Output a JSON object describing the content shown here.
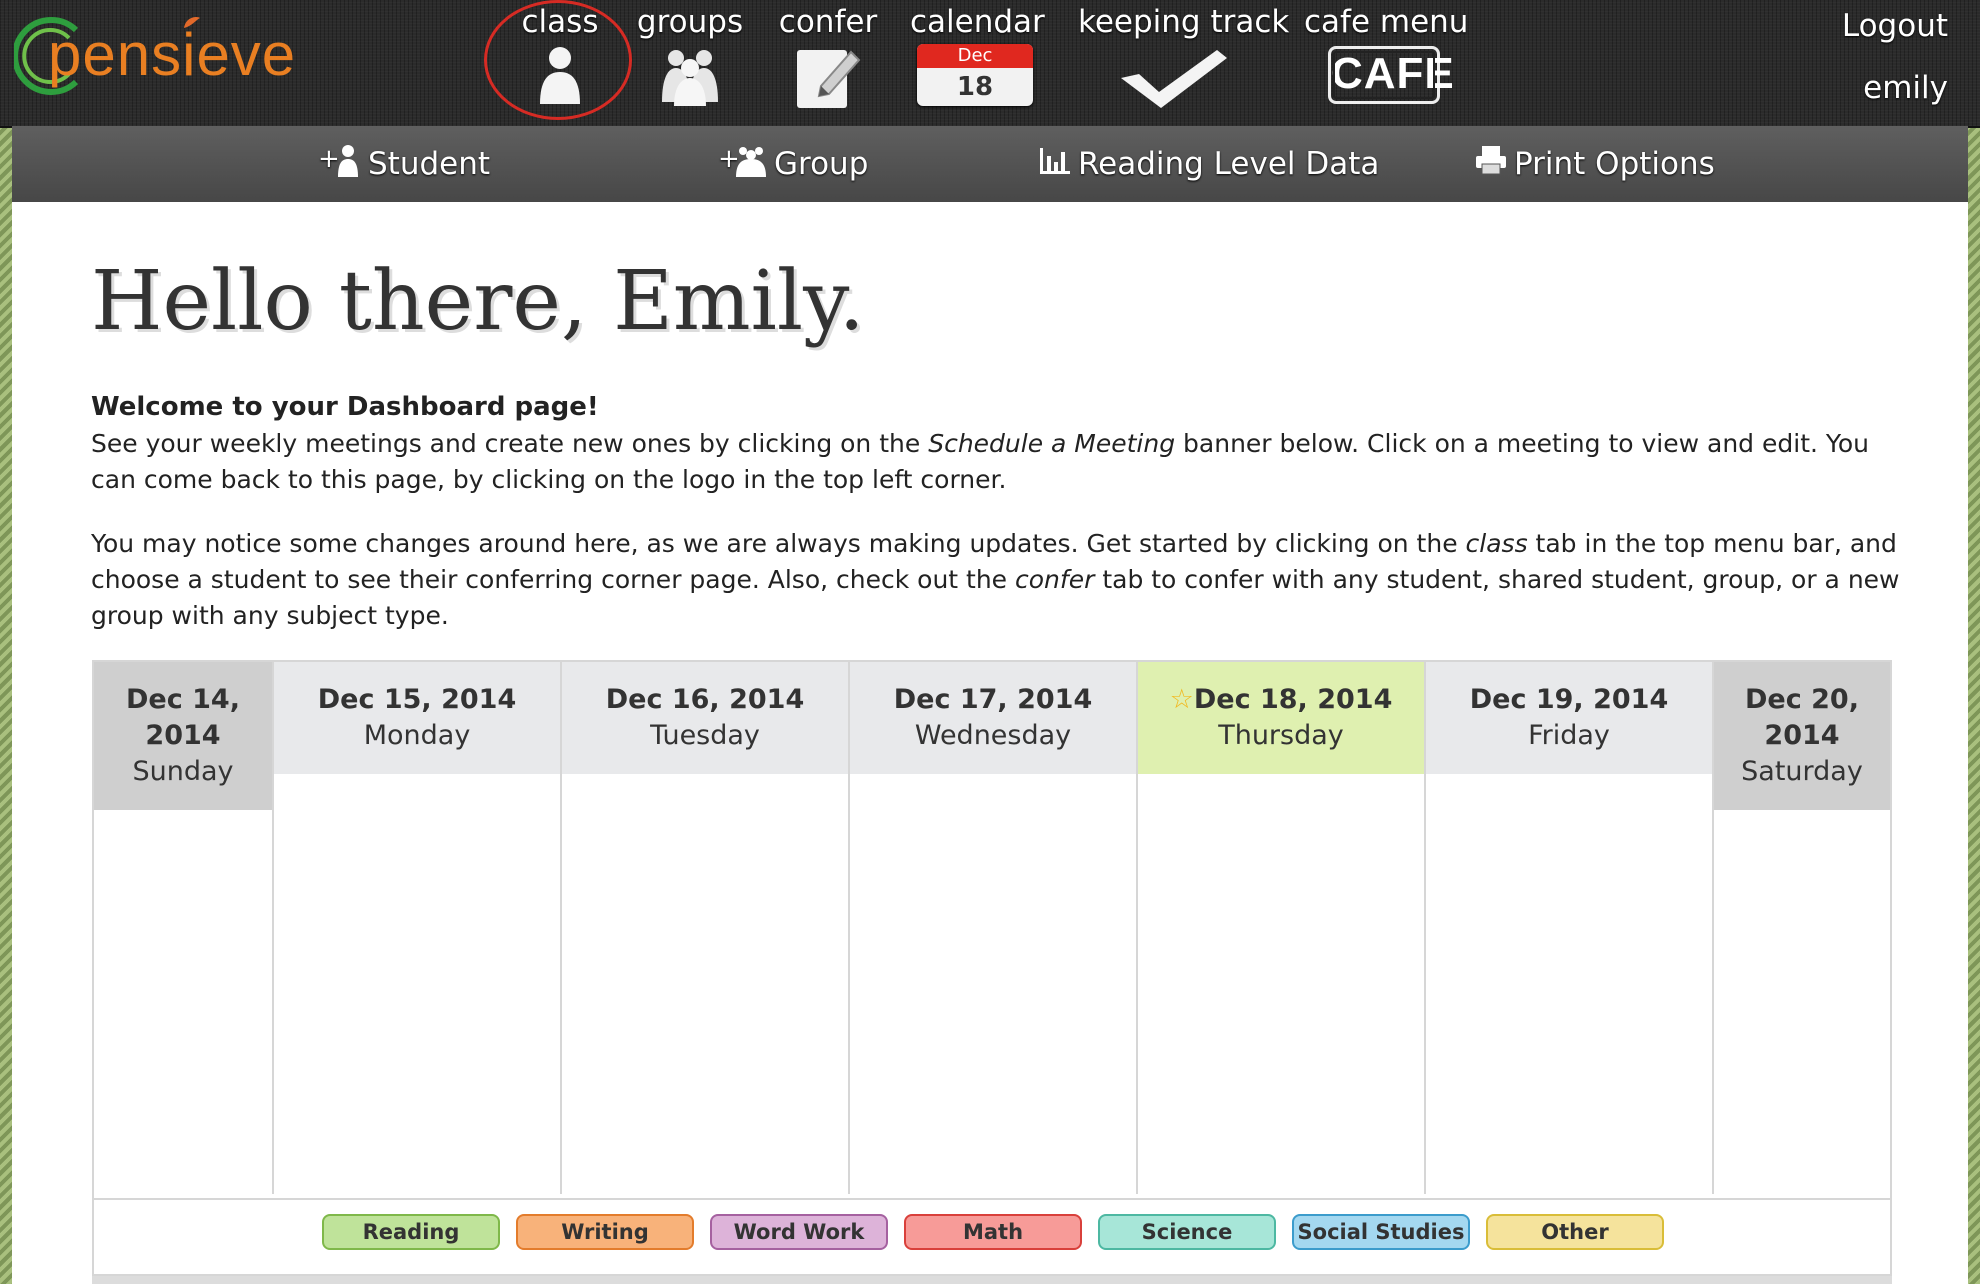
{
  "app": {
    "logo_text": "pensieve"
  },
  "nav": {
    "class": "class",
    "groups": "groups",
    "confer": "confer",
    "calendar": "calendar",
    "calendar_month": "Dec",
    "calendar_day": "18",
    "keeping_track": "keeping track",
    "cafe_menu": "cafe menu",
    "cafe_icon_text": "CAFE",
    "logout": "Logout",
    "username": "emily"
  },
  "subnav": {
    "student": "Student",
    "group": "Group",
    "reading_level": "Reading Level Data",
    "print": "Print Options"
  },
  "main": {
    "greeting": "Hello there, Emily.",
    "welcome_title": "Welcome to your Dashboard page!",
    "p1_a": "See your weekly meetings and create new ones by clicking on the ",
    "p1_em": "Schedule a Meeting",
    "p1_b": " banner below. Click on a meeting to view and edit. You can come back to this page, by clicking on the logo in the top left corner.",
    "p2_a": "You may notice some changes around here, as we are always making updates. Get started by clicking on the ",
    "p2_em1": "class",
    "p2_b": " tab in the top menu bar, and choose a student to see their conferring corner page. Also, check out the ",
    "p2_em2": "confer",
    "p2_c": " tab to confer with any student, shared student, group, or a new group with any subject type."
  },
  "calendar": {
    "days": [
      {
        "date": "Dec 14, 2014",
        "weekday": "Sunday"
      },
      {
        "date": "Dec 15, 2014",
        "weekday": "Monday"
      },
      {
        "date": "Dec 16, 2014",
        "weekday": "Tuesday"
      },
      {
        "date": "Dec 17, 2014",
        "weekday": "Wednesday"
      },
      {
        "date": "Dec 18, 2014",
        "weekday": "Thursday",
        "today": true
      },
      {
        "date": "Dec 19, 2014",
        "weekday": "Friday"
      },
      {
        "date": "Dec 20, 2014",
        "weekday": "Saturday"
      }
    ],
    "colors": {
      "weekend": "#cfcfcf",
      "weekday": "#e8e9eb",
      "today": "#dff0b0",
      "star": "#f2b81e"
    }
  },
  "legend": [
    {
      "label": "Reading",
      "bg": "#bfe39a",
      "border": "#7fb84a"
    },
    {
      "label": "Writing",
      "bg": "#f8b27a",
      "border": "#e37c2c"
    },
    {
      "label": "Word Work",
      "bg": "#ddb3d9",
      "border": "#a561a0"
    },
    {
      "label": "Math",
      "bg": "#f79b98",
      "border": "#d9403b"
    },
    {
      "label": "Science",
      "bg": "#a7e6d8",
      "border": "#4db8a2"
    },
    {
      "label": "Social Studies",
      "bg": "#a4d8f0",
      "border": "#3c9ccc"
    },
    {
      "label": "Other",
      "bg": "#f5e39c",
      "border": "#d9bd38"
    }
  ]
}
